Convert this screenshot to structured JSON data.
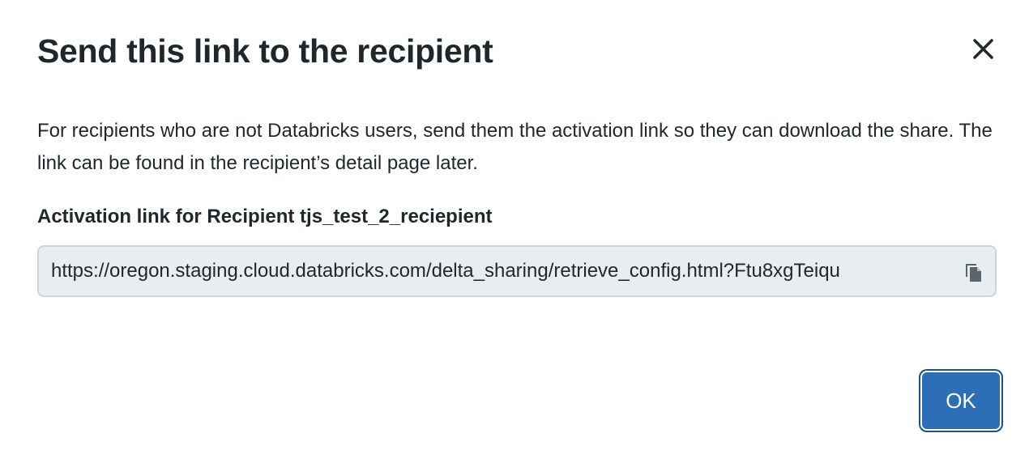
{
  "dialog": {
    "title": "Send this link to the recipient",
    "close_icon": "close-icon",
    "description": "For recipients who are not Databricks users, send them the activation link so they can download the share. The link can be found in the recipient’s detail page later.",
    "field_label": "Activation link for Recipient tjs_test_2_reciepient",
    "activation_link": "https://oregon.staging.cloud.databricks.com/delta_sharing/retrieve_config.html?Ftu8xgTeiqu",
    "copy_icon": "copy-icon",
    "ok_label": "OK"
  },
  "colors": {
    "primary": "#2d6fb6",
    "link_box_bg": "#e8edf1",
    "text": "#1f272d"
  }
}
